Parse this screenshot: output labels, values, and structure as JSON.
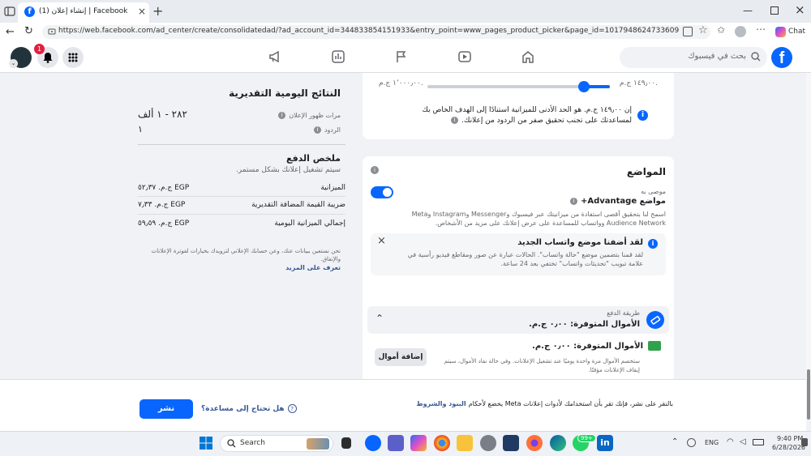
{
  "browser": {
    "tab_title": "(1) إنشاء إعلان | Facebook",
    "url": "https://web.facebook.com/ad_center/create/consolidatedad/?ad_account_id=344833854151933&entry_point=www_pages_product_picker&page_id=1017948624733609",
    "profile_label": "Chat"
  },
  "fb": {
    "search_placeholder": "بحث في فيسبوك",
    "notification_count": "1"
  },
  "budget": {
    "min_label": "١٤٩٫٠٠ ج.م.",
    "max_label": "١٬٠٠٠٫٠٠ ج.م.",
    "slider_level": 0.14,
    "note_line1": "إن ١٤٩٫٠٠ ج.م. هو الحد الأدنى للميزانية استنادًا إلى الهدف الخاص بك",
    "note_line2": "لمساعدتك على تجنب تحقيق صفر من الردود من إعلانك."
  },
  "placements": {
    "title": "المواضع",
    "recommended": "موصى به",
    "advantage_title": "مواضع Advantage+",
    "advantage_desc_line1": "اسمح لنا بتحقيق أقصى استفادة من ميزانيتك عبر فيسبوك وMessenger وInstagram وMeta",
    "advantage_desc_line2": "Audience Network وواتساب للمساعدة على عرض إعلانك على مزيد من الأشخاص.",
    "toggle_on": true,
    "notice_title": "لقد أضفنا موضع واتساب الجديد",
    "notice_line1": "لقد قمنا بتضمين موضع \"حالة واتساب\". الحالات عبارة عن صور ومقاطع فيديو رأسية في",
    "notice_line2": "علامة تبويب \"تحديثات واتساب\" تختفي بعد 24 ساعة."
  },
  "payment": {
    "section_label": "طريقة الدفع",
    "available_funds": "الأموال المتوفرة: ٠٫٠٠ ج.م.",
    "funds_row": "الأموال المتوفرة: ٠٫٠٠ ج.م.",
    "add_funds_button": "إضافة أموال",
    "desc_line1": "ستخصم الأموال مرة واحدة يوميًا عند تشغيل الإعلانات. وفي حالة نفاد الأموال، سيتم",
    "desc_line2": "إيقاف الإعلانات مؤقتًا."
  },
  "results": {
    "title": "النتائج اليومية التقديرية",
    "impressions_label": "مرات ظهور الإعلان",
    "impressions_value": "٢٨٢ - ١ ألف",
    "replies_label": "الردود",
    "replies_value": "١"
  },
  "summary": {
    "title": "ملخص الدفع",
    "subtitle": "سيتم تشغيل إعلانك بشكل مستمر.",
    "rows": [
      {
        "label": "الميزانية",
        "value": "ج.م. ٥٢٫٣٧ EGP"
      },
      {
        "label": "ضريبة القيمة المضافة التقديرية",
        "value": "ج.م. ٧٫٣٣ EGP"
      },
      {
        "label": "إجمالي الميزانية اليومية",
        "value": "ج.م. ٥٩٫٥٩ EGP"
      }
    ],
    "footnote_line1": "نحن نستعين ببيانات عنك، وعن حسابك الإعلاني لتزويدك بخيارات لفوترة الإعلانات",
    "footnote_line2": "والإنفاق.",
    "learn_more": "تعرف على المزيد"
  },
  "footer": {
    "publish_button": "نشر",
    "help_link": "هل تحتاج إلى مساعدة؟",
    "terms_prefix": "بالنقر على نشر، فإنك تقر بأن استخدامك لأدوات إعلانات Meta يخضع لأحكام",
    "terms_link": "البنود والشروط"
  },
  "taskbar": {
    "search": "Search",
    "lang": "ENG",
    "time": "9:40 PM",
    "date": "6/28/2026",
    "badge": "99+"
  },
  "colors": {
    "fb_blue": "#0866ff",
    "link_blue": "#385898"
  }
}
